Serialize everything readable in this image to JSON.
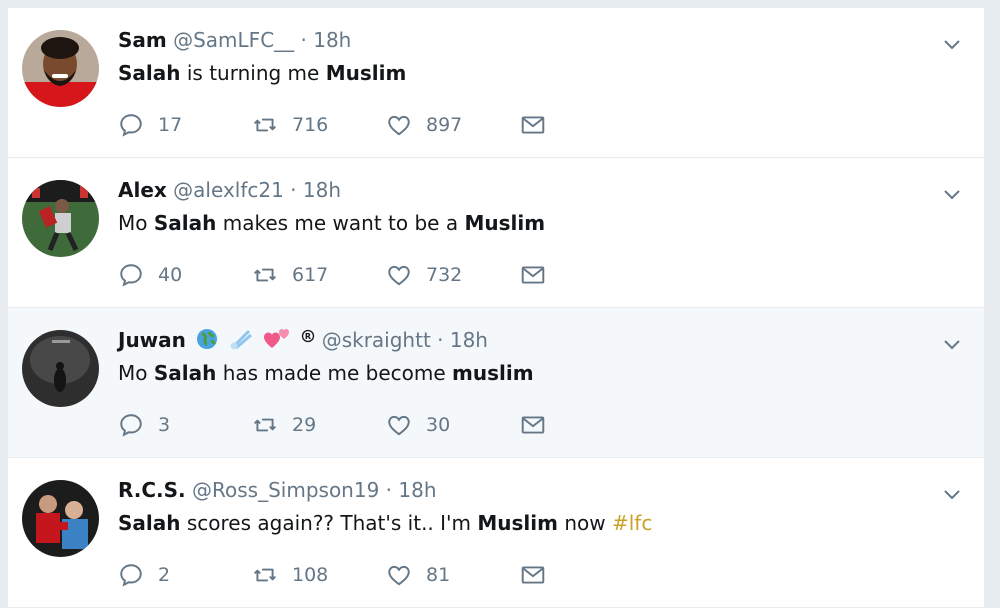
{
  "tweets": [
    {
      "name": "Sam",
      "handle": "@SamLFC__",
      "sep": " · ",
      "time": "18h",
      "text_parts": [
        "Salah",
        " is turning me ",
        "Muslim"
      ],
      "replies": "17",
      "retweets": "716",
      "likes": "897",
      "avatar": "avatar-sam"
    },
    {
      "name": "Alex",
      "handle": "@alexlfc21",
      "sep": " · ",
      "time": "18h",
      "text_parts": [
        "Mo ",
        "Salah",
        " makes me want to be a ",
        "Muslim"
      ],
      "replies": "40",
      "retweets": "617",
      "likes": "732",
      "avatar": "avatar-alex"
    },
    {
      "name": "Juwan",
      "name_icons": [
        "globe-emoji",
        "comet-emoji",
        "hearts-emoji",
        "registered-icon"
      ],
      "handle": "@skraightt",
      "sep": " · ",
      "time": "18h",
      "text_parts": [
        "Mo ",
        "Salah",
        " has made me become ",
        "muslim"
      ],
      "replies": "3",
      "retweets": "29",
      "likes": "30",
      "avatar": "avatar-juwan"
    },
    {
      "name": "R.C.S.",
      "handle": "@Ross_Simpson19",
      "sep": " · ",
      "time": "18h",
      "text_parts": [
        "Salah",
        " scores again?? That's it.. I'm ",
        "Muslim",
        " now "
      ],
      "hashtag": "#lfc",
      "hashtag_color": "#c9a227",
      "replies": "2",
      "retweets": "108",
      "likes": "81",
      "avatar": "avatar-rcs"
    }
  ],
  "colors": {
    "page_bg": "#e6ecf0",
    "card_bg": "#ffffff",
    "highlight_bg": "#f5f8fa",
    "muted": "#657786",
    "text": "#14171a"
  }
}
